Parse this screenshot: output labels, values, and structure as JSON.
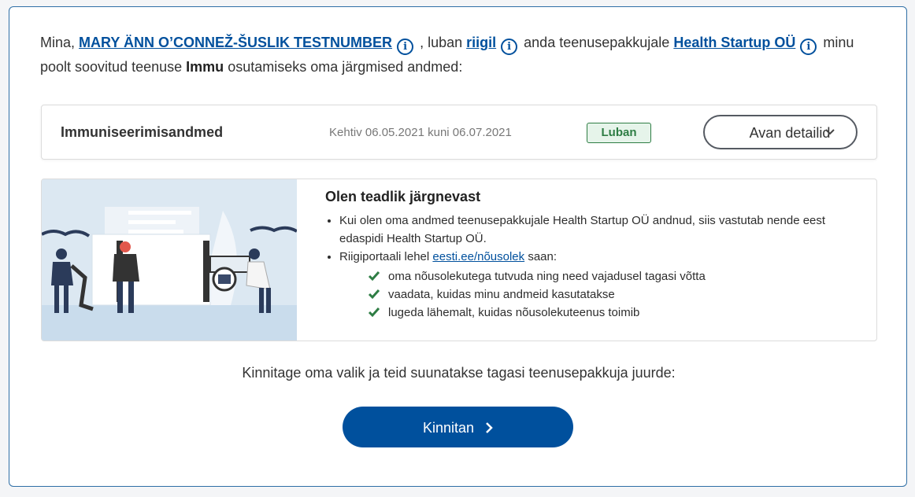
{
  "intro": {
    "prefix": "Mina,",
    "person_link": "MARY ÄNN O’CONNEŽ-ŠUSLIK TESTNUMBER",
    "after_person": ", luban",
    "grantor_link": "riigil",
    "after_grantor": "anda teenusepakkujale",
    "provider_link": "Health Startup OÜ",
    "after_provider": "minu poolt soovitud teenuse",
    "service_name": "Immu",
    "suffix": "osutamiseks oma järgmised andmed:",
    "info_glyph": "i"
  },
  "data_item": {
    "title": "Immuniseerimisandmed",
    "validity": "Kehtiv 06.05.2021 kuni 06.07.2021",
    "status_badge": "Luban",
    "details_button": "Avan detailid",
    "details_icon": "chevron-down-icon"
  },
  "notice": {
    "title": "Olen teadlik järgnevast",
    "bullet1": "Kui olen oma andmed teenusepakkujale Health Startup OÜ andnud, siis vastutab nende eest edaspidi Health Startup OÜ.",
    "bullet2_prefix": "Riigiportaali lehel",
    "bullet2_link": "eesti.ee/nõusolek",
    "bullet2_suffix": "saan:",
    "checks": [
      "oma nõusolekutega tutvuda ning need vajadusel tagasi võtta",
      "vaadata, kuidas minu andmeid kasutatakse",
      "lugeda lähemalt, kuidas nõusolekuteenus toimib"
    ]
  },
  "confirm": {
    "text": "Kinnitage oma valik ja teid suunatakse tagasi teenusepakkuja juurde:",
    "button": "Kinnitan",
    "button_icon": "chevron-right-icon"
  },
  "colors": {
    "primary": "#00509d",
    "success": "#2e7d44",
    "border": "#2f6fa6"
  }
}
